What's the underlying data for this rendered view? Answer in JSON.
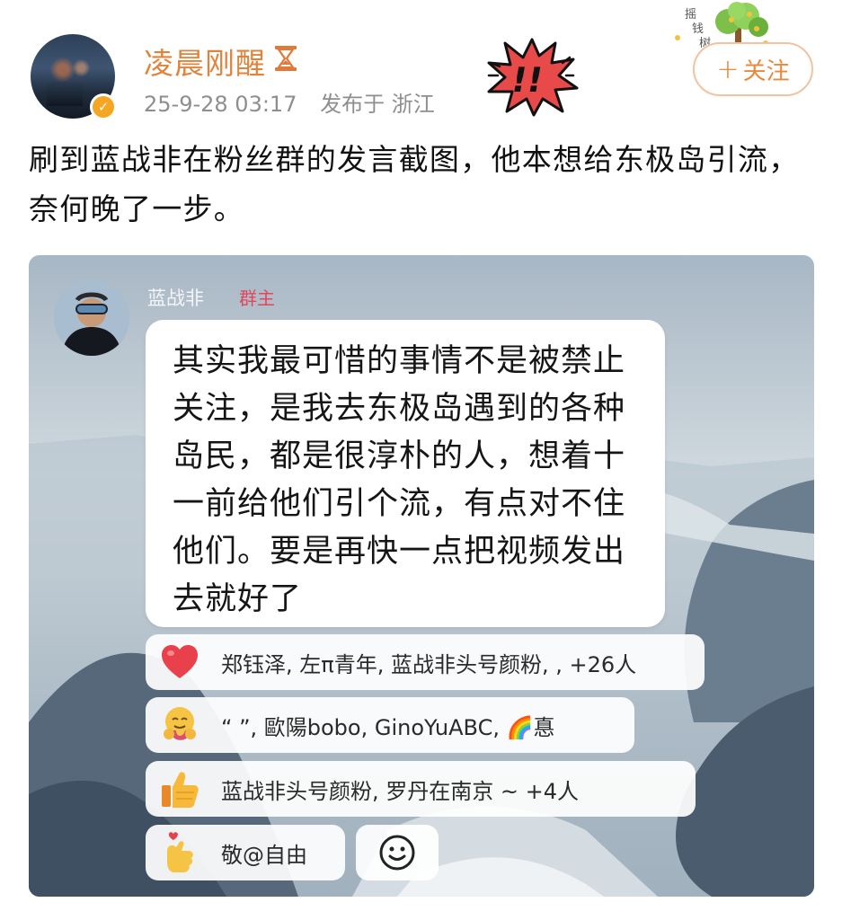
{
  "post": {
    "username": "凌晨刚醒",
    "date": "25-9-28 03:17",
    "location": "发布于 浙江",
    "follow_label": "关注",
    "follow_plus": "+",
    "text": "刷到蓝战非在粉丝群的发言截图，他本想给东极岛引流，奈何晚了一步。",
    "badge_color": "#f5a623",
    "accent_color": "#e0843c"
  },
  "chat": {
    "sender_name": "蓝战非",
    "sender_role": "群主",
    "message": "其实我最可惜的事情不是被禁止关注，是我去东极岛遇到的各种岛民，都是很淳朴的人，想着十一前给他们引个流，有点对不住他们。要是再快一点把视频发出去就好了",
    "reactions": [
      {
        "icon": "heart-icon",
        "text": "郑钰泽, 左π青年, 蓝战非头号颜粉, , +26人"
      },
      {
        "icon": "hug-emoji-icon",
        "text": "“  ”, 歐陽bobo, GinoYuABC, 🌈惪"
      },
      {
        "icon": "thumbs-up-icon",
        "text": "蓝战非头号颜粉, 罗丹在南京 ~          +4人"
      },
      {
        "icon": "finger-heart-icon",
        "text": "敬@自由"
      }
    ]
  },
  "icons": {
    "verified": "verified-badge-icon",
    "hourglass": "hourglass-icon",
    "exclaim": "exclaim-sticker-icon",
    "tree": "money-tree-icon",
    "smiley": "smiley-face-icon"
  }
}
